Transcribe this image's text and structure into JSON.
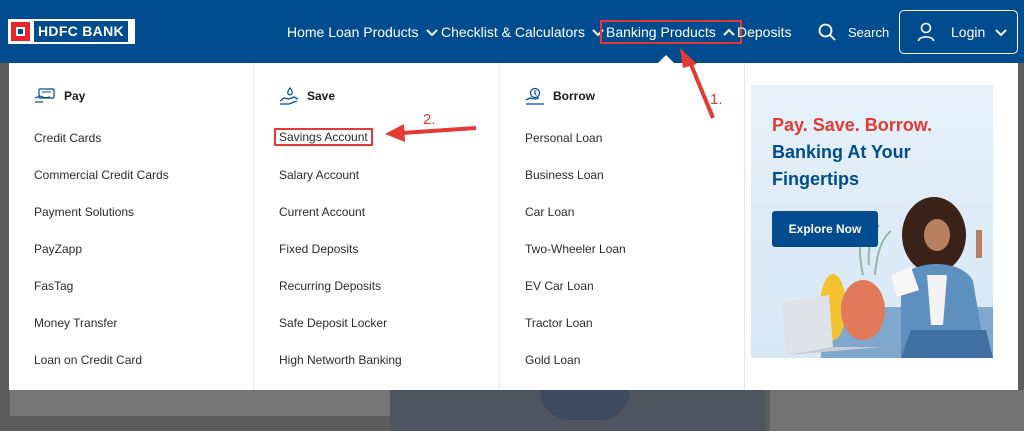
{
  "header": {
    "brand": "HDFC BANK",
    "nav": [
      {
        "label": "Home Loan Products"
      },
      {
        "label": "Checklist & Calculators"
      },
      {
        "label": "Banking Products"
      },
      {
        "label": "Deposits"
      }
    ],
    "search_label": "Search",
    "login_label": "Login"
  },
  "menu": {
    "columns": [
      {
        "heading": "Pay",
        "items": [
          "Credit Cards",
          "Commercial Credit Cards",
          "Payment Solutions",
          "PayZapp",
          "FasTag",
          "Money Transfer",
          "Loan on Credit Card"
        ]
      },
      {
        "heading": "Save",
        "items": [
          "Savings Account",
          "Salary Account",
          "Current Account",
          "Fixed Deposits",
          "Recurring Deposits",
          "Safe Deposit Locker",
          "High Networth Banking"
        ]
      },
      {
        "heading": "Borrow",
        "items": [
          "Personal Loan",
          "Business Loan",
          "Car Loan",
          "Two-Wheeler Loan",
          "EV Car Loan",
          "Tractor Loan",
          "Gold Loan"
        ]
      }
    ],
    "promo": {
      "line1": "Pay. Save. Borrow.",
      "line2": "Banking At Your",
      "line3": "Fingertips",
      "button": "Explore Now"
    }
  },
  "annotations": {
    "step1": "1.",
    "step2": "2."
  },
  "colors": {
    "brand_blue": "#004c8f",
    "brand_red": "#ed232a",
    "annotation_red": "#e53935"
  }
}
